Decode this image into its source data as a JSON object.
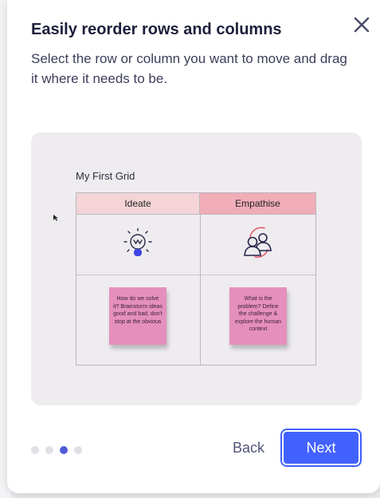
{
  "dialog": {
    "title": "Easily reorder rows and columns",
    "subtitle": "Select the row or column you want to move and drag it where it needs to be.",
    "close_icon": "close-icon"
  },
  "preview": {
    "grid_title": "My First Grid",
    "columns": [
      "Ideate",
      "Empathise"
    ],
    "icons": [
      "lightbulb-icon",
      "people-icon"
    ],
    "notes": [
      "How do we solve it? Brainstorm ideas good and bad, don't stop at the obvious",
      "What is the problem? Define the challenge & explore the human context"
    ]
  },
  "pagination": {
    "total": 4,
    "active_index": 2
  },
  "buttons": {
    "back": "Back",
    "next": "Next"
  },
  "colors": {
    "accent": "#4262ff",
    "dot_active": "#4f5bd5",
    "header_ideate": "#f4d4d7",
    "header_empathise": "#f0adb8",
    "sticky_note": "#e58fbd"
  }
}
